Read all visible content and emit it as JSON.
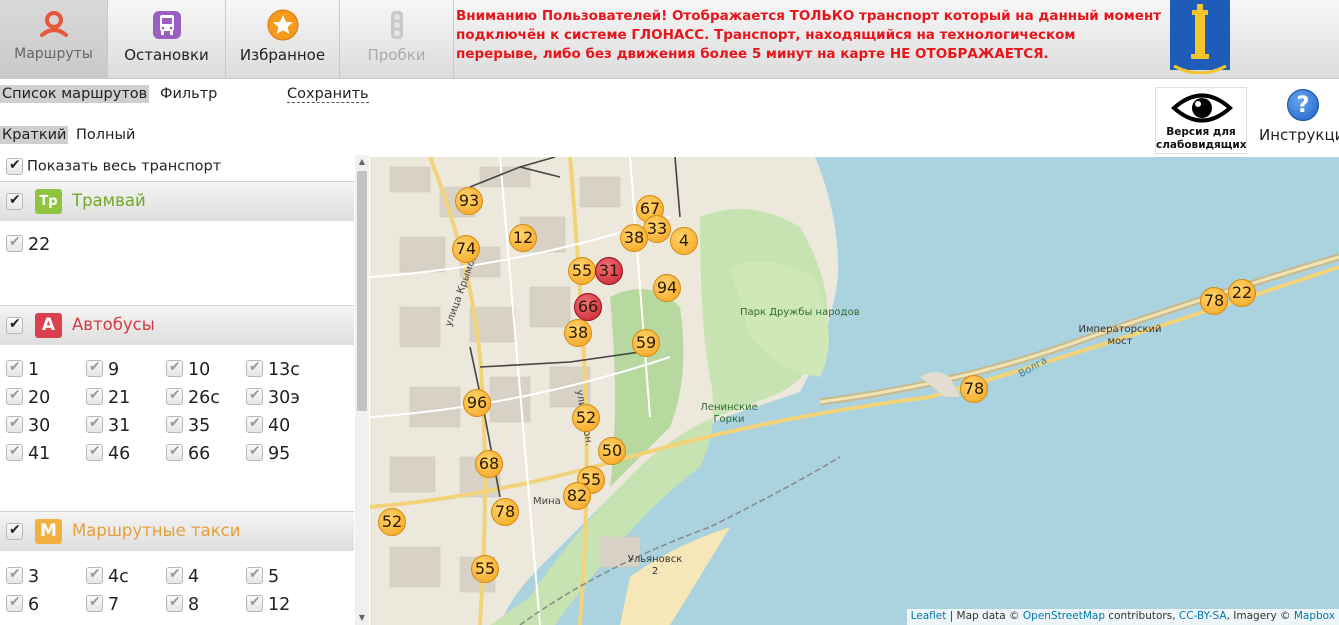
{
  "nav": {
    "routes": "Маршруты",
    "stops": "Остановки",
    "favorites": "Избранное",
    "traffic": "Пробки"
  },
  "notice": "Вниманию Пользователей! Отображается ТОЛЬКО транспорт который на данный момент подключён к системе ГЛОНАСС. Транспорт, находящийся на технологическом перерыве, либо без движения более 5 минут на карте НЕ ОТОБРАЖАЕТСЯ.",
  "tabs": {
    "list": "Список маршрутов",
    "filter": "Фильтр",
    "save": "Сохранить"
  },
  "modes": {
    "short": "Краткий",
    "full": "Полный"
  },
  "accessibility": {
    "line1": "Версия для",
    "line2": "слабовидящих"
  },
  "help": "Инструкция",
  "show_all": "Показать весь транспорт",
  "groups": {
    "tram": {
      "icon": "Тр",
      "name": "Трамвай",
      "color": "#8fc43f",
      "routes": [
        "22"
      ]
    },
    "bus": {
      "icon": "А",
      "name": "Автобусы",
      "color": "#d9414f",
      "routes": [
        "1",
        "9",
        "10",
        "13с",
        "20",
        "21",
        "26с",
        "30э",
        "30",
        "31",
        "35",
        "40",
        "41",
        "46",
        "66",
        "95"
      ]
    },
    "taxi": {
      "icon": "М",
      "name": "Маршрутные такси",
      "color": "#f2b040",
      "routes": [
        "3",
        "4с",
        "4",
        "5",
        "6",
        "7",
        "8",
        "12"
      ]
    }
  },
  "map": {
    "labels": {
      "park": "Парк Дружбы народов",
      "bridge": "Императорский мост",
      "volga": "Волга",
      "lenin_hills": "Ленинские Горки",
      "station": "Ульяновск 2",
      "street_crimea": "улица Крымова",
      "street_gon": "улица Гон.",
      "street_min": "Мина"
    },
    "vehicles": [
      {
        "n": "93",
        "c": "orange"
      },
      {
        "n": "74",
        "c": "orange"
      },
      {
        "n": "12",
        "c": "orange"
      },
      {
        "n": "67",
        "c": "orange"
      },
      {
        "n": "33",
        "c": "orange"
      },
      {
        "n": "38",
        "c": "orange"
      },
      {
        "n": "4",
        "c": "orange"
      },
      {
        "n": "55",
        "c": "orange"
      },
      {
        "n": "31",
        "c": "red"
      },
      {
        "n": "94",
        "c": "orange"
      },
      {
        "n": "66",
        "c": "red"
      },
      {
        "n": "38",
        "c": "orange"
      },
      {
        "n": "59",
        "c": "orange"
      },
      {
        "n": "96",
        "c": "orange"
      },
      {
        "n": "52",
        "c": "orange"
      },
      {
        "n": "50",
        "c": "orange"
      },
      {
        "n": "68",
        "c": "orange"
      },
      {
        "n": "55",
        "c": "orange"
      },
      {
        "n": "82",
        "c": "orange"
      },
      {
        "n": "78",
        "c": "orange"
      },
      {
        "n": "52",
        "c": "orange"
      },
      {
        "n": "55",
        "c": "orange"
      },
      {
        "n": "78",
        "c": "orange"
      },
      {
        "n": "78",
        "c": "orange"
      },
      {
        "n": "22",
        "c": "orange"
      }
    ],
    "attribution": {
      "leaflet": "Leaflet",
      "text1": " | Map data © ",
      "osm": "OpenStreetMap",
      "text2": " contributors, ",
      "cc": "CC-BY-SA",
      "text3": ", Imagery © ",
      "mapbox": "Mapbox"
    }
  }
}
